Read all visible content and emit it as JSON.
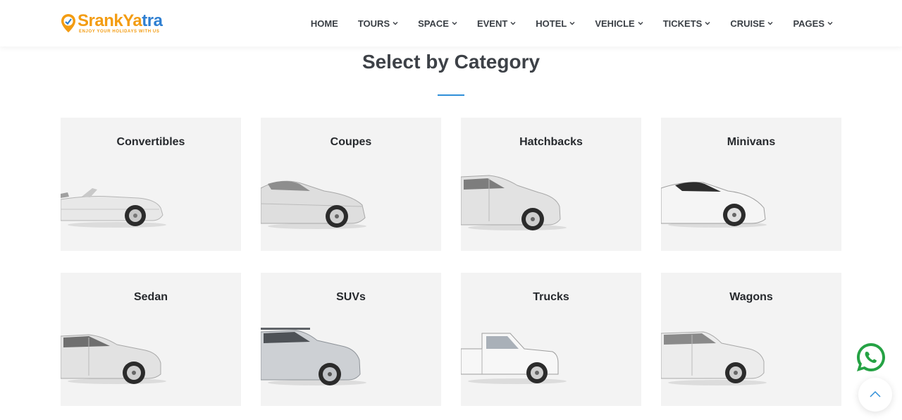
{
  "header": {
    "logo": {
      "text_main": "SrankYa",
      "text_accent": "tra",
      "tagline": "ENJOY YOUR HOLIDAYS WITH US"
    },
    "nav": [
      {
        "label": "HOME",
        "dropdown": false
      },
      {
        "label": "TOURS",
        "dropdown": true
      },
      {
        "label": "SPACE",
        "dropdown": true
      },
      {
        "label": "EVENT",
        "dropdown": true
      },
      {
        "label": "HOTEL",
        "dropdown": true
      },
      {
        "label": "VEHICLE",
        "dropdown": true
      },
      {
        "label": "TICKETS",
        "dropdown": true
      },
      {
        "label": "CRUISE",
        "dropdown": true
      },
      {
        "label": "PAGES",
        "dropdown": true
      }
    ]
  },
  "section": {
    "title": "Select by Category",
    "accent_color": "#2f8fd8"
  },
  "categories": [
    {
      "label": "Convertibles",
      "icon": "convertible-car"
    },
    {
      "label": "Coupes",
      "icon": "coupe-car"
    },
    {
      "label": "Hatchbacks",
      "icon": "hatchback-car"
    },
    {
      "label": "Minivans",
      "icon": "sports-car"
    },
    {
      "label": "Sedan",
      "icon": "sedan-car"
    },
    {
      "label": "SUVs",
      "icon": "suv-car"
    },
    {
      "label": "Trucks",
      "icon": "pickup-truck"
    },
    {
      "label": "Wagons",
      "icon": "wagon-car"
    }
  ],
  "floating": {
    "whatsapp_icon": "whatsapp-icon",
    "scroll_top_icon": "chevron-up-icon",
    "whatsapp_color": "#25a244"
  }
}
